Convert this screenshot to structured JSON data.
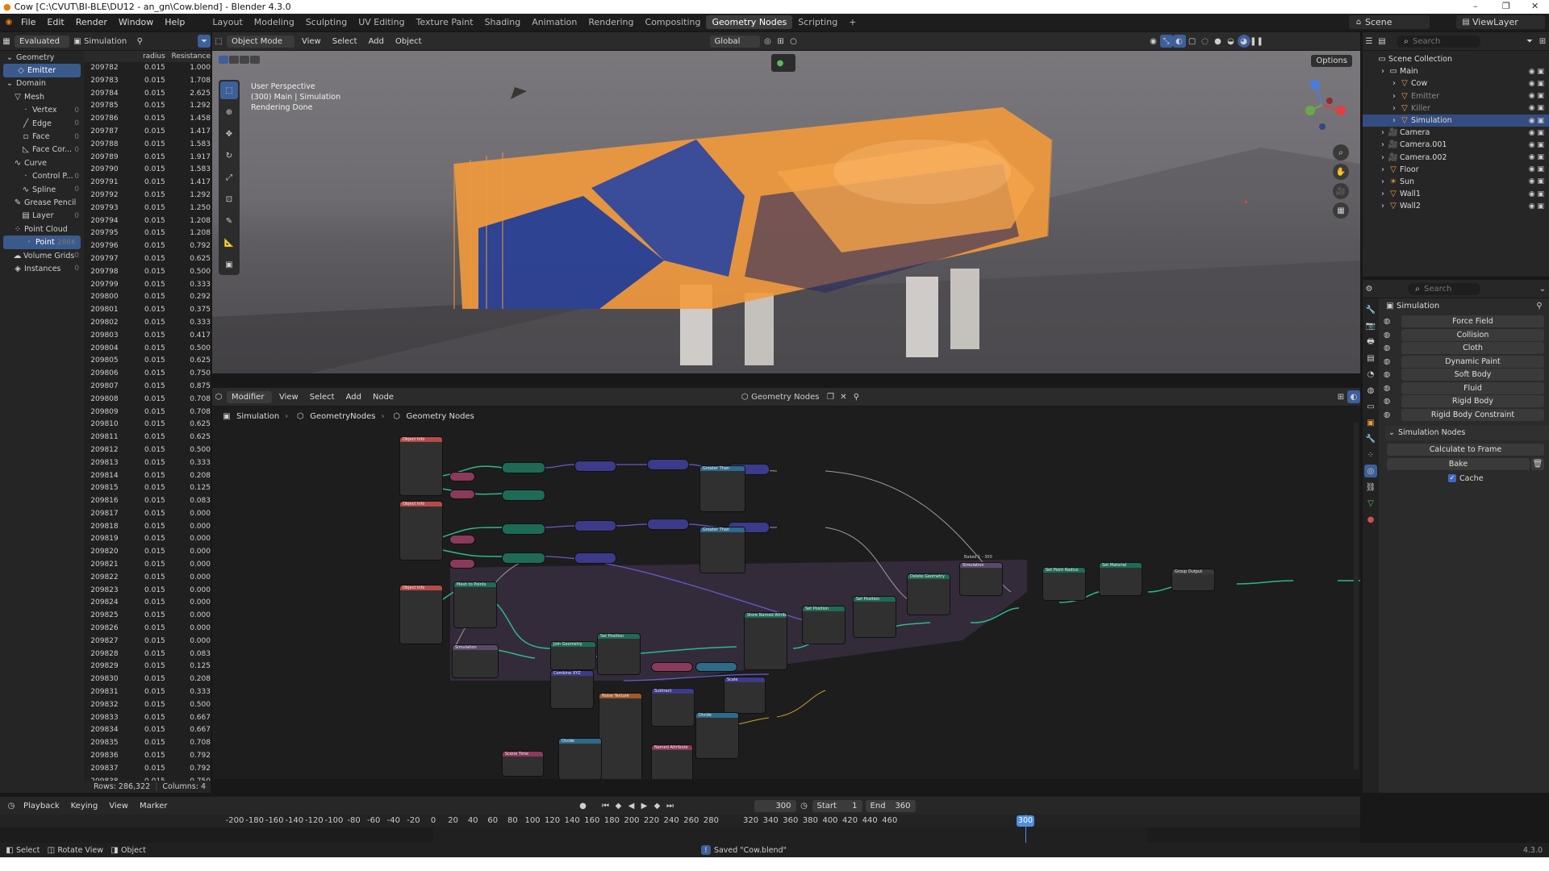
{
  "window": {
    "title": "Cow [C:\\CVUT\\BI-BLE\\DU12 - an_gn\\Cow.blend] - Blender 4.3.0",
    "controls": [
      "–",
      "❐",
      "✕"
    ]
  },
  "topbar": {
    "menus": [
      "File",
      "Edit",
      "Render",
      "Window",
      "Help"
    ],
    "workspaces": [
      "Layout",
      "Modeling",
      "Sculpting",
      "UV Editing",
      "Texture Paint",
      "Shading",
      "Animation",
      "Rendering",
      "Compositing",
      "Geometry Nodes",
      "Scripting"
    ],
    "active_workspace": "Geometry Nodes",
    "add_workspace": "+",
    "scene": "Scene",
    "view_layer": "ViewLayer"
  },
  "spreadsheet": {
    "evaluated": "Evaluated",
    "object": "Simulation",
    "tree": [
      {
        "label": "Geometry",
        "level": 0,
        "count": ""
      },
      {
        "label": "Emitter",
        "level": 1,
        "count": "",
        "selected": true
      },
      {
        "label": "Domain",
        "level": 0,
        "count": ""
      },
      {
        "label": "Mesh",
        "level": 1,
        "count": ""
      },
      {
        "label": "Vertex",
        "level": 2,
        "count": "0"
      },
      {
        "label": "Edge",
        "level": 2,
        "count": "0"
      },
      {
        "label": "Face",
        "level": 2,
        "count": "0"
      },
      {
        "label": "Face Cor...",
        "level": 2,
        "count": "0"
      },
      {
        "label": "Curve",
        "level": 1,
        "count": ""
      },
      {
        "label": "Control P...",
        "level": 2,
        "count": "0"
      },
      {
        "label": "Spline",
        "level": 2,
        "count": "0"
      },
      {
        "label": "Grease Pencil",
        "level": 1,
        "count": ""
      },
      {
        "label": "Layer",
        "level": 2,
        "count": "0"
      },
      {
        "label": "Point Cloud",
        "level": 1,
        "count": ""
      },
      {
        "label": "Point",
        "level": 2,
        "count": "286K",
        "selected": true
      },
      {
        "label": "Volume Grids",
        "level": 1,
        "count": "0"
      },
      {
        "label": "Instances",
        "level": 1,
        "count": "0"
      }
    ],
    "columns": [
      "radius",
      "Resistance"
    ],
    "rows": [
      [
        "209782",
        "0.015",
        "1.000"
      ],
      [
        "209783",
        "0.015",
        "1.708"
      ],
      [
        "209784",
        "0.015",
        "2.625"
      ],
      [
        "209785",
        "0.015",
        "1.292"
      ],
      [
        "209786",
        "0.015",
        "1.458"
      ],
      [
        "209787",
        "0.015",
        "1.417"
      ],
      [
        "209788",
        "0.015",
        "1.583"
      ],
      [
        "209789",
        "0.015",
        "1.917"
      ],
      [
        "209790",
        "0.015",
        "1.583"
      ],
      [
        "209791",
        "0.015",
        "1.417"
      ],
      [
        "209792",
        "0.015",
        "1.292"
      ],
      [
        "209793",
        "0.015",
        "1.250"
      ],
      [
        "209794",
        "0.015",
        "1.208"
      ],
      [
        "209795",
        "0.015",
        "1.208"
      ],
      [
        "209796",
        "0.015",
        "0.792"
      ],
      [
        "209797",
        "0.015",
        "0.625"
      ],
      [
        "209798",
        "0.015",
        "0.500"
      ],
      [
        "209799",
        "0.015",
        "0.333"
      ],
      [
        "209800",
        "0.015",
        "0.292"
      ],
      [
        "209801",
        "0.015",
        "0.375"
      ],
      [
        "209802",
        "0.015",
        "0.333"
      ],
      [
        "209803",
        "0.015",
        "0.417"
      ],
      [
        "209804",
        "0.015",
        "0.500"
      ],
      [
        "209805",
        "0.015",
        "0.625"
      ],
      [
        "209806",
        "0.015",
        "0.750"
      ],
      [
        "209807",
        "0.015",
        "0.875"
      ],
      [
        "209808",
        "0.015",
        "0.708"
      ],
      [
        "209809",
        "0.015",
        "0.708"
      ],
      [
        "209810",
        "0.015",
        "0.625"
      ],
      [
        "209811",
        "0.015",
        "0.625"
      ],
      [
        "209812",
        "0.015",
        "0.500"
      ],
      [
        "209813",
        "0.015",
        "0.333"
      ],
      [
        "209814",
        "0.015",
        "0.208"
      ],
      [
        "209815",
        "0.015",
        "0.125"
      ],
      [
        "209816",
        "0.015",
        "0.083"
      ],
      [
        "209817",
        "0.015",
        "0.000"
      ],
      [
        "209818",
        "0.015",
        "0.000"
      ],
      [
        "209819",
        "0.015",
        "0.000"
      ],
      [
        "209820",
        "0.015",
        "0.000"
      ],
      [
        "209821",
        "0.015",
        "0.000"
      ],
      [
        "209822",
        "0.015",
        "0.000"
      ],
      [
        "209823",
        "0.015",
        "0.000"
      ],
      [
        "209824",
        "0.015",
        "0.000"
      ],
      [
        "209825",
        "0.015",
        "0.000"
      ],
      [
        "209826",
        "0.015",
        "0.000"
      ],
      [
        "209827",
        "0.015",
        "0.000"
      ],
      [
        "209828",
        "0.015",
        "0.083"
      ],
      [
        "209829",
        "0.015",
        "0.125"
      ],
      [
        "209830",
        "0.015",
        "0.208"
      ],
      [
        "209831",
        "0.015",
        "0.333"
      ],
      [
        "209832",
        "0.015",
        "0.500"
      ],
      [
        "209833",
        "0.015",
        "0.667"
      ],
      [
        "209834",
        "0.015",
        "0.667"
      ],
      [
        "209835",
        "0.015",
        "0.708"
      ],
      [
        "209836",
        "0.015",
        "0.792"
      ],
      [
        "209837",
        "0.015",
        "0.792"
      ],
      [
        "209838",
        "0.015",
        "0.750"
      ]
    ],
    "footer_rows": "Rows: 286,322",
    "footer_cols": "Columns: 4"
  },
  "viewport": {
    "mode": "Object Mode",
    "menus": [
      "View",
      "Select",
      "Add",
      "Object"
    ],
    "transform": "Global",
    "options": "Options",
    "overlay_lines": [
      "User Perspective",
      "(300) Main | Simulation",
      "Rendering Done"
    ],
    "colors": {
      "particles": "#f39a3c",
      "blue": "#1a3a9a"
    }
  },
  "outliner": {
    "search": "Search",
    "items": [
      {
        "label": "Scene Collection",
        "level": 0,
        "icon": "collection-icon"
      },
      {
        "label": "Main",
        "level": 1,
        "icon": "collection-icon"
      },
      {
        "label": "Cow",
        "level": 2,
        "icon": "mesh-icon"
      },
      {
        "label": "Emitter",
        "level": 2,
        "icon": "mesh-icon",
        "dim": true
      },
      {
        "label": "Killer",
        "level": 2,
        "icon": "mesh-icon",
        "dim": true
      },
      {
        "label": "Simulation",
        "level": 2,
        "icon": "mesh-icon",
        "selected": true
      },
      {
        "label": "Camera",
        "level": 1,
        "icon": "camera-icon"
      },
      {
        "label": "Camera.001",
        "level": 1,
        "icon": "camera-icon"
      },
      {
        "label": "Camera.002",
        "level": 1,
        "icon": "camera-icon"
      },
      {
        "label": "Floor",
        "level": 1,
        "icon": "mesh-icon"
      },
      {
        "label": "Sun",
        "level": 1,
        "icon": "light-icon"
      },
      {
        "label": "Wall1",
        "level": 1,
        "icon": "mesh-icon"
      },
      {
        "label": "Wall2",
        "level": 1,
        "icon": "mesh-icon"
      }
    ]
  },
  "properties": {
    "search": "Search",
    "object": "Simulation",
    "physics": [
      "Force Field",
      "Collision",
      "Cloth",
      "Dynamic Paint",
      "Soft Body",
      "Fluid",
      "Rigid Body",
      "Rigid Body Constraint"
    ],
    "sim_nodes_label": "Simulation Nodes",
    "calculate": "Calculate to Frame",
    "bake": "Bake",
    "cache": "Cache"
  },
  "node_editor": {
    "header": {
      "modifier": "Modifier",
      "menus": [
        "View",
        "Select",
        "Add",
        "Node"
      ],
      "tree_name": "Geometry Nodes"
    },
    "breadcrumb": [
      "Simulation",
      "GeometryNodes",
      "Geometry Nodes"
    ],
    "zone_label": "Baked 1 - 300"
  },
  "timeline": {
    "menus": [
      "Playback",
      "Keying",
      "View",
      "Marker"
    ],
    "frame": "300",
    "start_label": "Start",
    "start": "1",
    "end_label": "End",
    "end": "360",
    "ticks": [
      "-200",
      "-180",
      "-160",
      "-140",
      "-120",
      "-100",
      "-80",
      "-60",
      "-40",
      "-20",
      "0",
      "20",
      "40",
      "60",
      "80",
      "100",
      "120",
      "140",
      "160",
      "180",
      "200",
      "220",
      "240",
      "260",
      "280",
      "300",
      "320",
      "340",
      "360",
      "380",
      "400",
      "420",
      "440",
      "460"
    ]
  },
  "statusbar": {
    "select": "Select",
    "rotate": "Rotate View",
    "object": "Object",
    "message": "Saved \"Cow.blend\"",
    "version": "4.3.0"
  }
}
